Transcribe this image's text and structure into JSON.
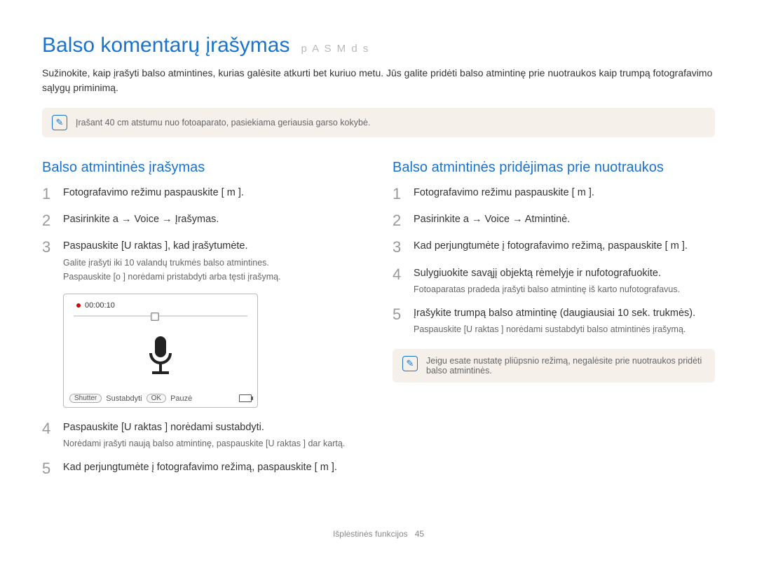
{
  "page": {
    "title": "Balso komentarų įrašymas",
    "modes": "p A S M d s",
    "intro": "Sužinokite, kaip įrašyti balso atmintines, kurias galėsite atkurti bet kuriuo metu. Jūs galite pridėti balso atmintinę prie nuotraukos kaip trumpą fotografavimo sąlygų priminimą.",
    "topnote_icon": "✎",
    "topnote": "Įrašant 40 cm atstumu nuo fotoaparato, pasiekiama geriausia garso kokybė."
  },
  "left": {
    "heading": "Balso atmintinės įrašymas",
    "steps": [
      {
        "n": "1",
        "text": "Fotografavimo režimu paspauskite [ m ]."
      },
      {
        "n": "2",
        "text": "Pasirinkite a  → Voice → Įrašymas."
      },
      {
        "n": "3",
        "text": "Paspauskite [U raktas ], kad įrašytumėte.",
        "subs": [
          "Galite įrašyti iki 10 valandų trukmės balso atmintines.",
          "Paspauskite [o ] norėdami pristabdyti arba tęsti įrašymą."
        ]
      },
      {
        "n": "4",
        "text": "Paspauskite [U raktas ] norėdami sustabdyti.",
        "subs": [
          "Norėdami įrašyti naują balso atmintinę, paspauskite [U raktas ] dar kartą."
        ]
      },
      {
        "n": "5",
        "text": "Kad perjungtumėte į fotografavimo režimą, paspauskite [ m ]."
      }
    ],
    "screen": {
      "time": "00:00:10",
      "btn_shutter": "Shutter",
      "btn_stop": "Sustabdyti",
      "btn_ok": "OK",
      "btn_pause": "Pauzė"
    }
  },
  "right": {
    "heading": "Balso atmintinės pridėjimas prie nuotraukos",
    "steps": [
      {
        "n": "1",
        "text": "Fotografavimo režimu paspauskite [ m ]."
      },
      {
        "n": "2",
        "text": "Pasirinkite a  → Voice → Atmintinė."
      },
      {
        "n": "3",
        "text": "Kad perjungtumėte į fotografavimo režimą, paspauskite [ m ]."
      },
      {
        "n": "4",
        "text": "Sulygiuokite savąjį objektą rėmelyje ir nufotografuokite.",
        "subs": [
          "Fotoaparatas pradeda įrašyti balso atmintinę iš karto nufotografavus."
        ]
      },
      {
        "n": "5",
        "text": "Įrašykite trumpą balso atmintinę (daugiausiai 10 sek. trukmės).",
        "subs": [
          "Paspauskite [U raktas ] norėdami sustabdyti balso atmintinės įrašymą."
        ]
      }
    ],
    "note_icon": "✎",
    "note": "Jeigu esate nustatę pliūpsnio režimą, negalėsite prie nuotraukos pridėti balso atmintinės."
  },
  "footer": {
    "label": "Išplėstinės funkcijos",
    "page": "45"
  }
}
